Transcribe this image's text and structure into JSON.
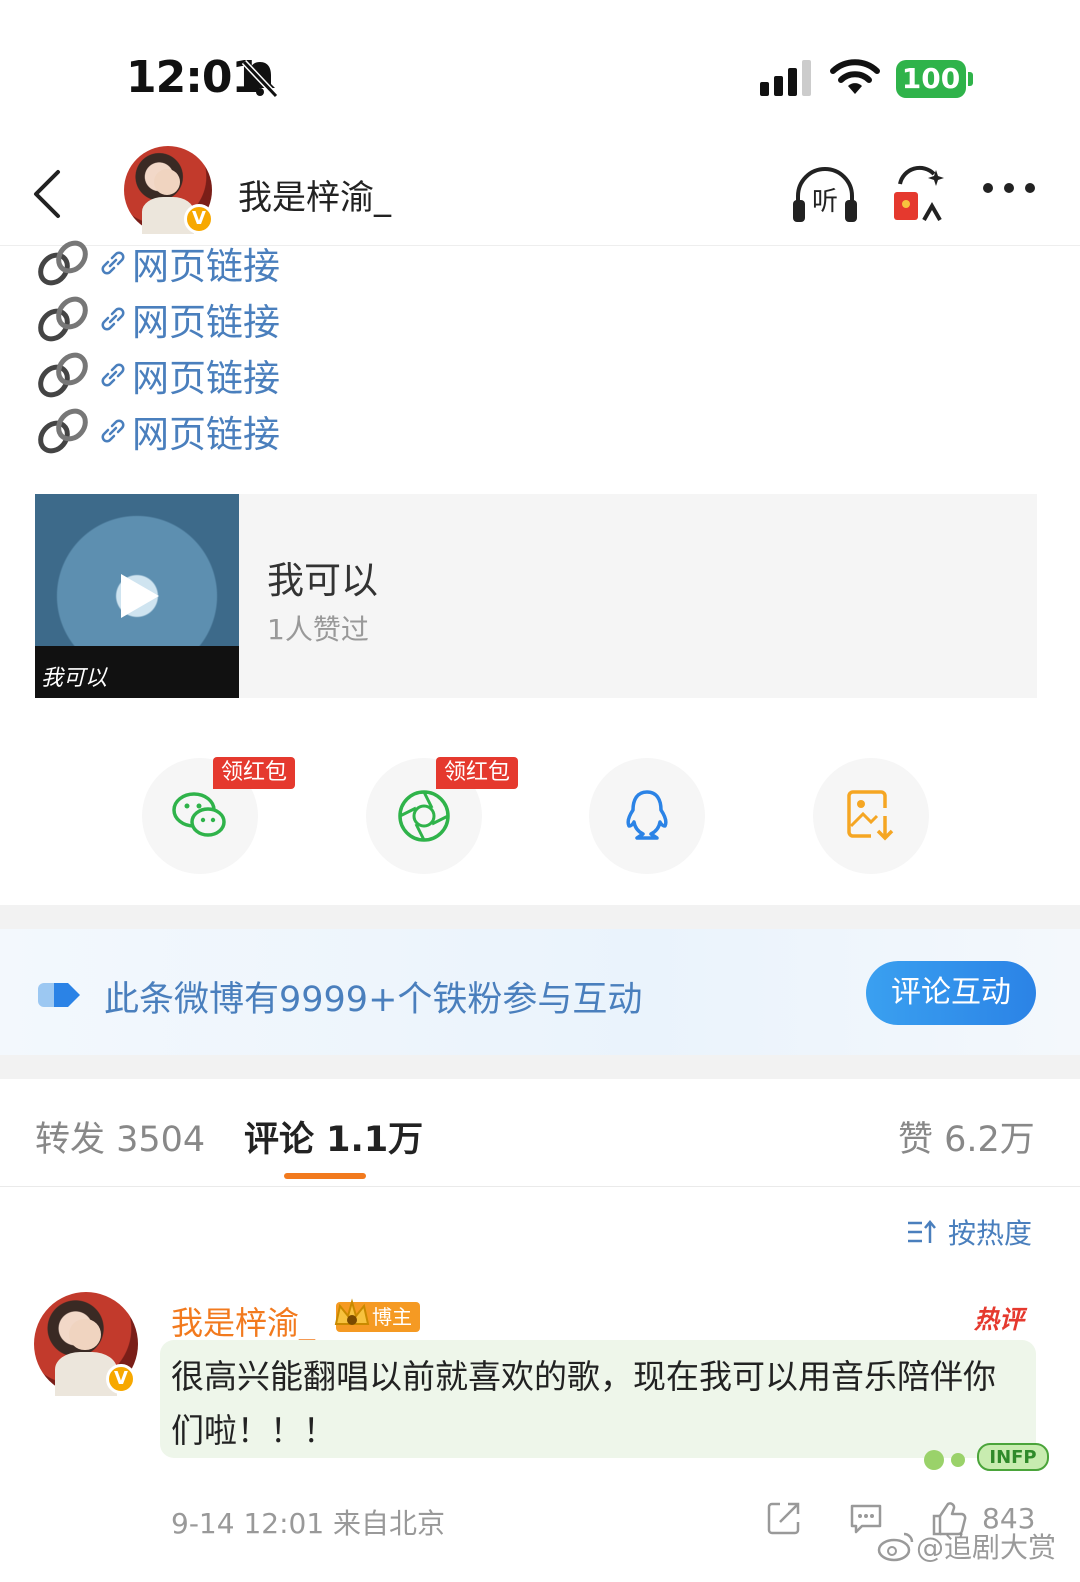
{
  "status_bar": {
    "time": "12:01",
    "battery": "100"
  },
  "nav": {
    "username": "我是梓渝_",
    "listen_label": "听"
  },
  "links": [
    {
      "text": "网页链接"
    },
    {
      "text": "网页链接"
    },
    {
      "text": "网页链接"
    },
    {
      "text": "网页链接"
    }
  ],
  "music": {
    "title": "我可以",
    "likes": "1人赞过",
    "cover_text": "我可以"
  },
  "share": {
    "redpack_label_1": "领红包",
    "redpack_label_2": "领红包"
  },
  "fans": {
    "text": "此条微博有9999+个铁粉参与互动",
    "button": "评论互动"
  },
  "tabs": {
    "repost": "转发 3504",
    "comment": "评论 1.1万",
    "like": "赞 6.2万"
  },
  "sort_label": "按热度",
  "comment": {
    "author": "我是梓渝_",
    "badge": "博主",
    "hot": "热评",
    "text": "很高兴能翻唱以前就喜欢的歌，现在我可以用音乐陪伴你们啦！！！",
    "meta": "9-14 12:01 来自北京",
    "likes": "843",
    "infp": "INFP"
  },
  "watermark": "@追剧大赏",
  "colors": {
    "accent_orange": "#f27a1e",
    "link_blue": "#4a7fbd",
    "badge_gold": "#f7a800",
    "red": "#e5392e",
    "battery_green": "#2fb34a"
  }
}
